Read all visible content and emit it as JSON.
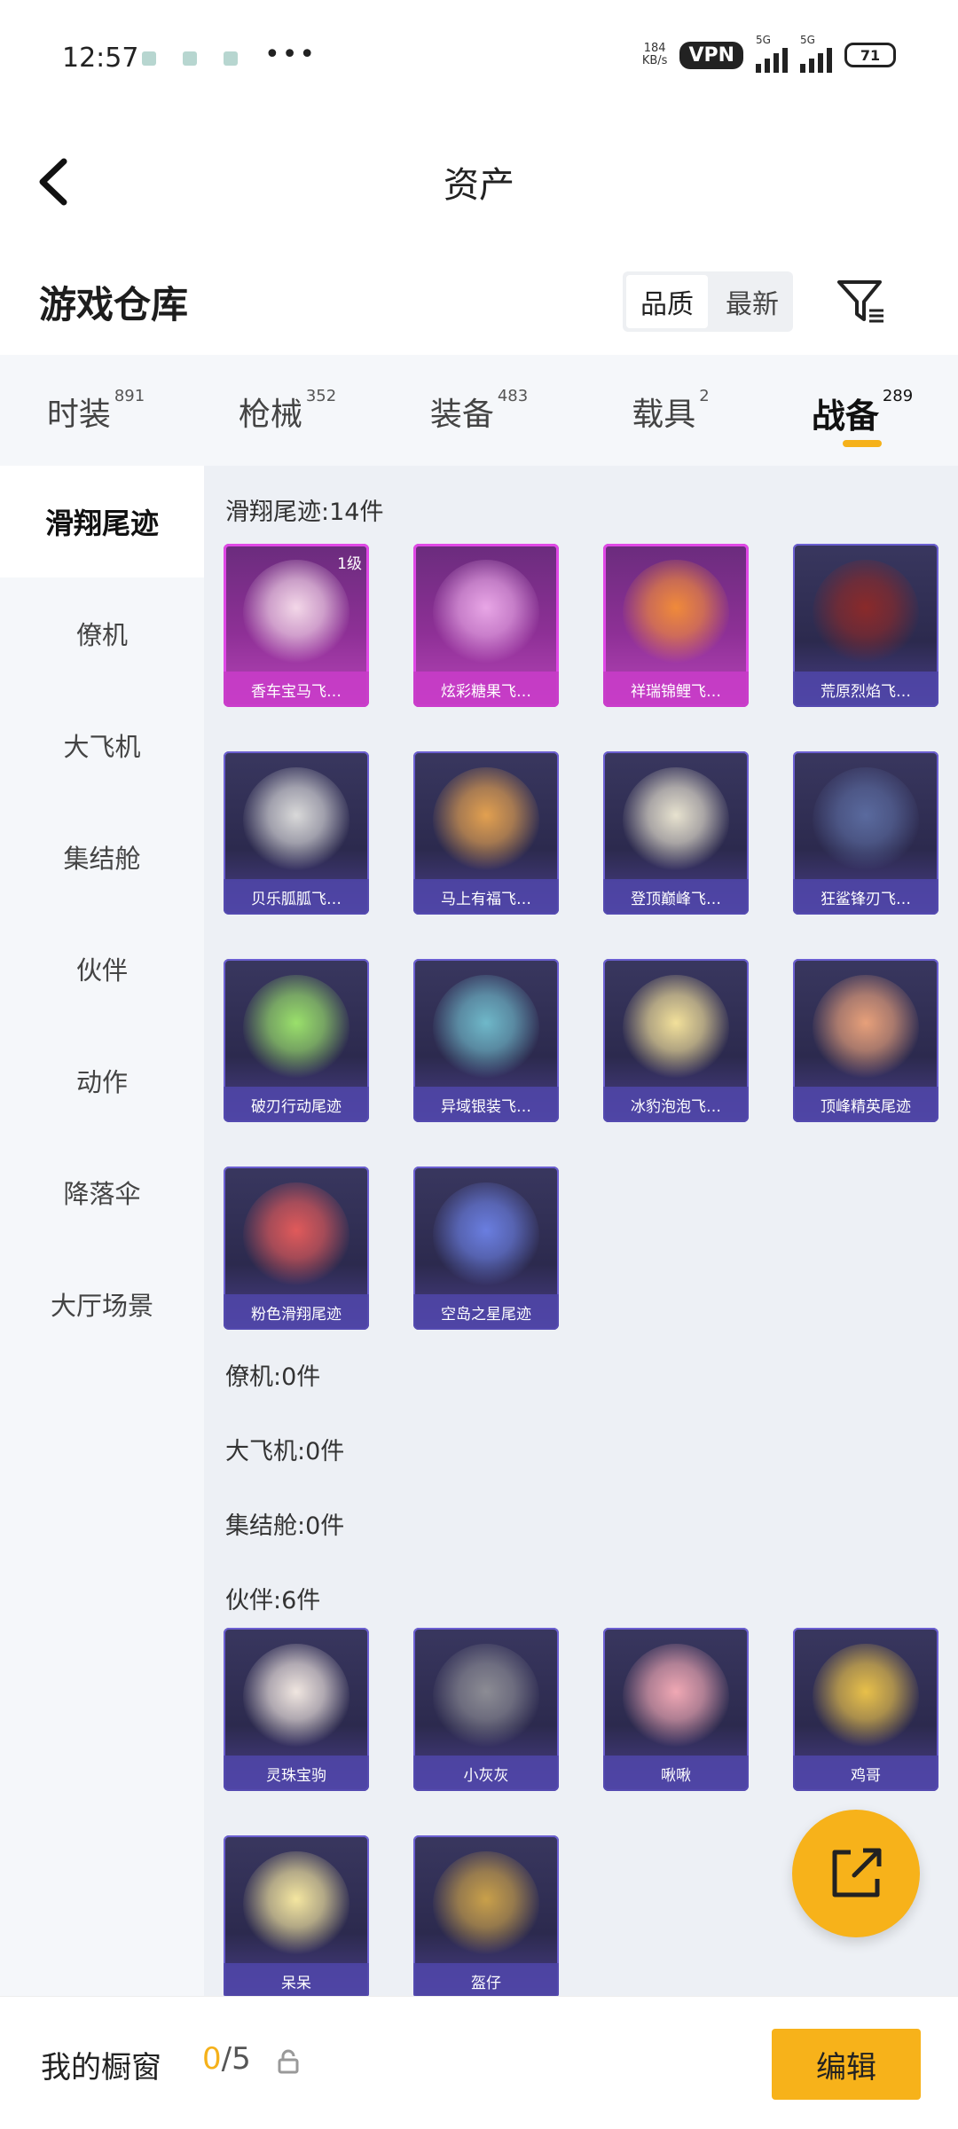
{
  "status": {
    "time": "12:57",
    "more": "•••",
    "speed_top": "184",
    "speed_bottom": "KB/s",
    "vpn": "VPN",
    "sim1": "5G",
    "sim2": "5G",
    "battery": "71"
  },
  "header": {
    "title": "资产"
  },
  "section": {
    "name": "游戏仓库",
    "sort": [
      "品质",
      "最新"
    ]
  },
  "tabs": [
    {
      "label": "时装",
      "count": "891"
    },
    {
      "label": "枪械",
      "count": "352"
    },
    {
      "label": "装备",
      "count": "483"
    },
    {
      "label": "载具",
      "count": "2"
    },
    {
      "label": "战备",
      "count": "289"
    }
  ],
  "sidebar": [
    "滑翔尾迹",
    "僚机",
    "大飞机",
    "集结舱",
    "伙伴",
    "动作",
    "降落伞",
    "大厅场景"
  ],
  "groups": {
    "trail_title": "滑翔尾迹:14件",
    "wingman_title": "僚机:0件",
    "bigplane_title": "大飞机:0件",
    "pod_title": "集结舱:0件",
    "partner_title": "伙伴:6件"
  },
  "trail_items": [
    {
      "name": "香车宝马飞…",
      "level": "1级",
      "color": "#f3d7e8"
    },
    {
      "name": "炫彩糖果飞…",
      "color": "#e8a6e6"
    },
    {
      "name": "祥瑞锦鲤飞…",
      "color": "#f08a3a"
    },
    {
      "name": "荒原烈焰飞…",
      "color": "#8a2a2a"
    },
    {
      "name": "贝乐胍胍飞…",
      "color": "#d9d9d9"
    },
    {
      "name": "马上有福飞…",
      "color": "#e2a050"
    },
    {
      "name": "登顶巅峰飞…",
      "color": "#e7e2cf"
    },
    {
      "name": "狂鲨锋刃飞…",
      "color": "#5a6a9e"
    },
    {
      "name": "破刃行动尾迹",
      "color": "#9ae06b"
    },
    {
      "name": "异域银装飞…",
      "color": "#6fb8c9"
    },
    {
      "name": "冰豹泡泡飞…",
      "color": "#f2e09a"
    },
    {
      "name": "顶峰精英尾迹",
      "color": "#e7a07a"
    },
    {
      "name": "粉色滑翔尾迹",
      "color": "#e05a5a"
    },
    {
      "name": "空岛之星尾迹",
      "color": "#6a7ee0"
    }
  ],
  "partner_items": [
    {
      "name": "灵珠宝驹",
      "color": "#f0e6e0"
    },
    {
      "name": "小灰灰",
      "color": "#8c8c94"
    },
    {
      "name": "啾啾",
      "color": "#f0a8b4"
    },
    {
      "name": "鸡哥",
      "color": "#e8c04a"
    },
    {
      "name": "呆呆",
      "color": "#f4e6a0"
    },
    {
      "name": "盔仔",
      "color": "#c9a04a"
    }
  ],
  "bottom": {
    "label": "我的橱窗",
    "current": "0",
    "total": "/5",
    "edit": "编辑"
  },
  "colors": {
    "accent": "#f7b21a",
    "pink_card": "#e048e6",
    "purple_card": "#6b5fd1"
  }
}
